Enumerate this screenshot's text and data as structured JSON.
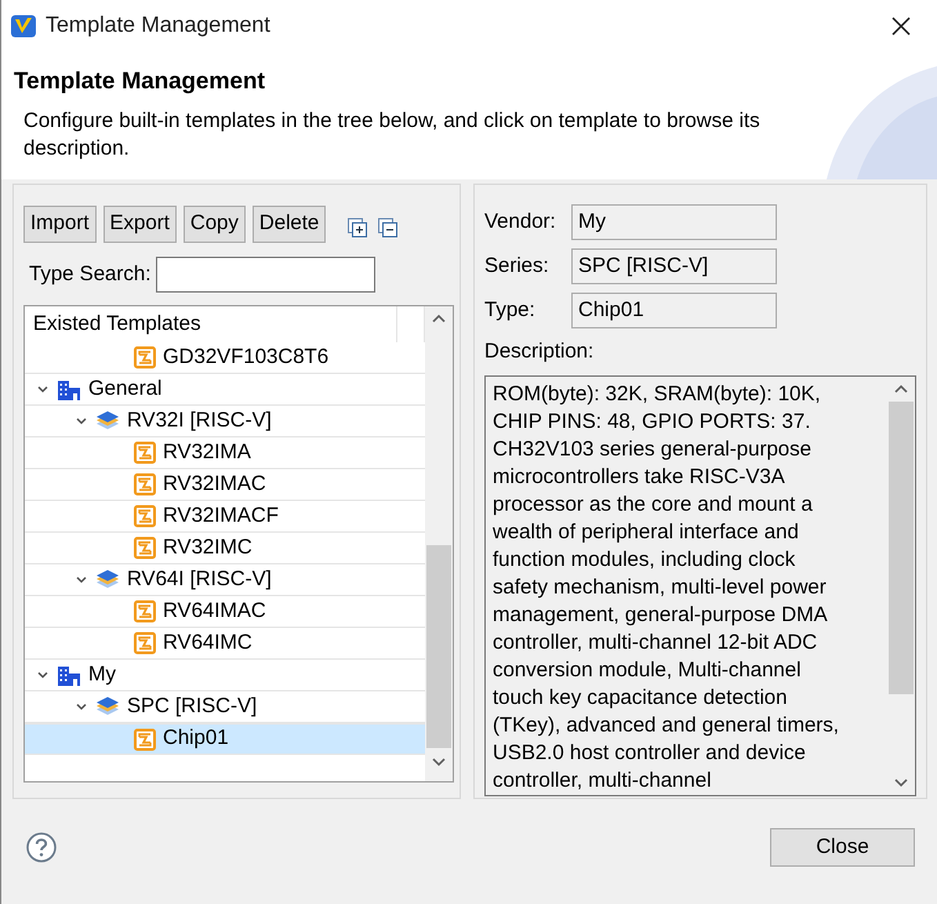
{
  "window": {
    "title": "Template Management"
  },
  "header": {
    "title": "Template Management",
    "description": "Configure built-in templates in the tree below, and click on template to browse its description."
  },
  "toolbar": {
    "buttons": [
      "Import",
      "Export",
      "Copy",
      "Delete"
    ]
  },
  "search": {
    "label": "Type Search:"
  },
  "tree": {
    "column": "Existed Templates",
    "nodes": [
      {
        "kind": "offscreen",
        "children": [
          {
            "kind": "offscreen",
            "children": [
              {
                "kind": "template",
                "label": "GD32VF103C8T6",
                "selected": false
              }
            ]
          }
        ]
      },
      {
        "kind": "vendor",
        "label": "General",
        "expanded": true,
        "selected": false,
        "children": [
          {
            "kind": "series",
            "label": "RV32I [RISC-V]",
            "expanded": true,
            "selected": false,
            "children": [
              {
                "kind": "template",
                "label": "RV32IMA",
                "selected": false
              },
              {
                "kind": "template",
                "label": "RV32IMAC",
                "selected": false
              },
              {
                "kind": "template",
                "label": "RV32IMACF",
                "selected": false
              },
              {
                "kind": "template",
                "label": "RV32IMC",
                "selected": false
              }
            ]
          },
          {
            "kind": "series",
            "label": "RV64I [RISC-V]",
            "expanded": true,
            "selected": false,
            "children": [
              {
                "kind": "template",
                "label": "RV64IMAC",
                "selected": false
              },
              {
                "kind": "template",
                "label": "RV64IMC",
                "selected": false
              }
            ]
          }
        ]
      },
      {
        "kind": "vendor",
        "label": "My",
        "expanded": true,
        "selected": false,
        "children": [
          {
            "kind": "series",
            "label": "SPC [RISC-V]",
            "expanded": true,
            "selected": false,
            "children": [
              {
                "kind": "template",
                "label": "Chip01",
                "selected": true
              }
            ]
          }
        ]
      }
    ]
  },
  "details": {
    "fields": [
      {
        "label": "Vendor:",
        "value": "My"
      },
      {
        "label": "Series:",
        "value": "SPC [RISC-V]"
      },
      {
        "label": "Type:",
        "value": "Chip01"
      }
    ],
    "description_label": "Description:",
    "description_lines": [
      "ROM(byte): 32K, SRAM(byte): 10K,",
      "CHIP PINS: 48, GPIO PORTS: 37.",
      "CH32V103 series general-purpose",
      "microcontrollers take RISC-V3A",
      "processor as the core and mount a",
      "wealth of peripheral interface and",
      "function modules, including clock",
      "safety mechanism, multi-level power",
      "management, general-purpose DMA",
      "controller, multi-channel 12-bit ADC",
      "conversion module, Multi-channel",
      "touch key capacitance detection",
      "(TKey), advanced and general timers,",
      "USB2.0 host controller and device",
      "controller, multi-channel"
    ]
  },
  "buttons": [
    "Close"
  ]
}
